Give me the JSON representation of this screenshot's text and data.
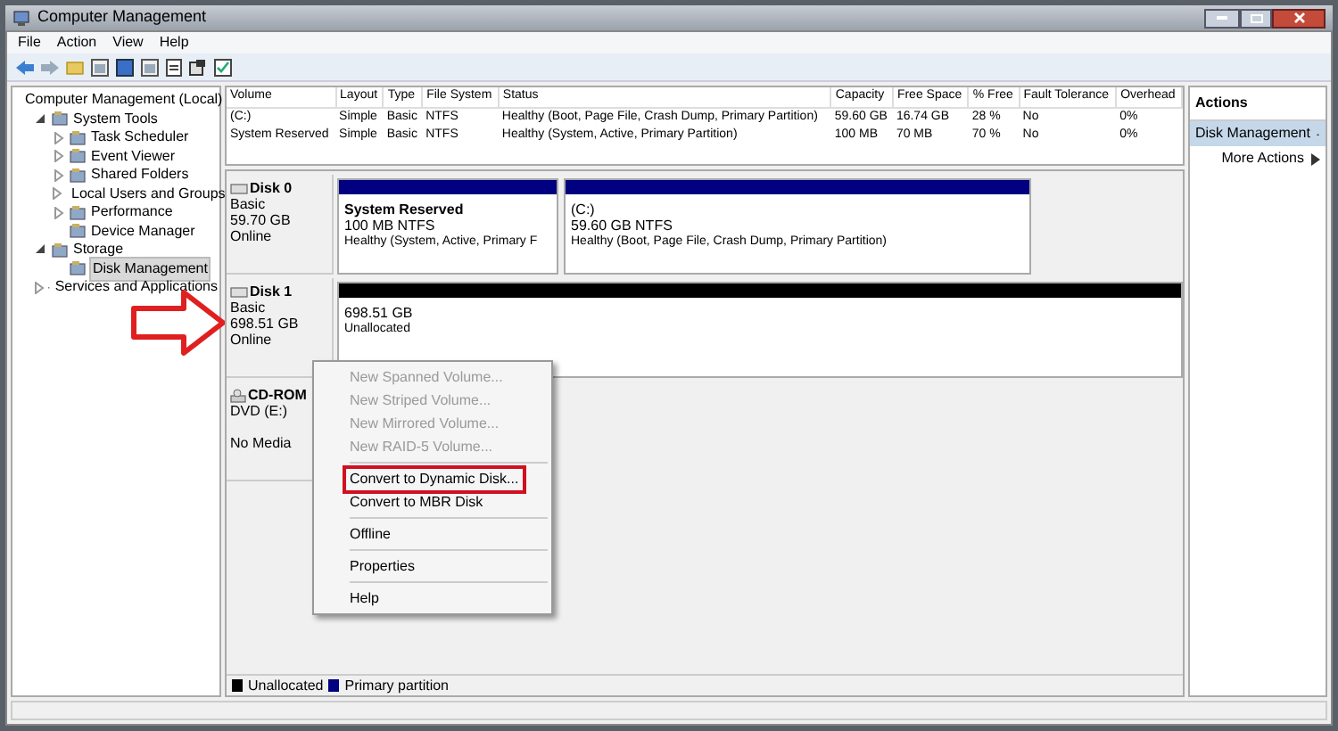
{
  "window": {
    "title": "Computer Management"
  },
  "menu": [
    "File",
    "Action",
    "View",
    "Help"
  ],
  "tree": [
    {
      "label": "Computer Management (Local)",
      "selected": false,
      "children": [
        {
          "label": "System Tools",
          "expanded": true,
          "selected": false,
          "children": [
            {
              "label": "Task Scheduler",
              "expanded": false,
              "selected": false
            },
            {
              "label": "Event Viewer",
              "expanded": false,
              "selected": false
            },
            {
              "label": "Shared Folders",
              "expanded": false,
              "selected": false
            },
            {
              "label": "Local Users and Groups",
              "expanded": false,
              "selected": false
            },
            {
              "label": "Performance",
              "expanded": false,
              "selected": false
            },
            {
              "label": "Device Manager",
              "selected": false
            }
          ]
        },
        {
          "label": "Storage",
          "expanded": true,
          "selected": false,
          "children": [
            {
              "label": "Disk Management",
              "selected": true
            }
          ]
        },
        {
          "label": "Services and Applications",
          "expanded": false,
          "selected": false
        }
      ]
    }
  ],
  "volumes": {
    "columns": [
      "Volume",
      "Layout",
      "Type",
      "File System",
      "Status",
      "Capacity",
      "Free Space",
      "% Free",
      "Fault Tolerance",
      "Overhead"
    ],
    "rows": [
      [
        "(C:)",
        "Simple",
        "Basic",
        "NTFS",
        "Healthy (Boot, Page File, Crash Dump, Primary Partition)",
        "59.60 GB",
        "16.74 GB",
        "28 %",
        "No",
        "0%"
      ],
      [
        "System Reserved",
        "Simple",
        "Basic",
        "NTFS",
        "Healthy (System, Active, Primary Partition)",
        "100 MB",
        "70 MB",
        "70 %",
        "No",
        "0%"
      ]
    ]
  },
  "disks": [
    {
      "kind": "disk",
      "name": "Disk 0",
      "type": "Basic",
      "size": "59.70 GB",
      "status": "Online",
      "partitions": [
        {
          "title": "System Reserved",
          "size": "100 MB NTFS",
          "status": "Healthy (System, Active, Primary F",
          "color": "#000080"
        },
        {
          "title": "(C:)",
          "size": "59.60 GB NTFS",
          "status": "Healthy (Boot, Page File, Crash Dump, Primary Partition)",
          "color": "#000080"
        }
      ]
    },
    {
      "kind": "disk",
      "name": "Disk 1",
      "type": "Basic",
      "size": "698.51 GB",
      "status": "Online",
      "partitions": [
        {
          "size": "698.51 GB",
          "status": "Unallocated",
          "color": "#000000"
        }
      ]
    },
    {
      "kind": "cdrom",
      "name": "CD-ROM",
      "type": "DVD (E:)",
      "status": "No Media"
    }
  ],
  "context_menu": [
    {
      "label": "New Spanned Volume...",
      "disabled": true,
      "highlighted": false,
      "separator_after": false
    },
    {
      "label": "New Striped Volume...",
      "disabled": true,
      "highlighted": false,
      "separator_after": false
    },
    {
      "label": "New Mirrored Volume...",
      "disabled": true,
      "highlighted": false,
      "separator_after": false
    },
    {
      "label": "New RAID-5 Volume...",
      "disabled": true,
      "highlighted": false,
      "separator_after": true
    },
    {
      "label": "Convert to Dynamic Disk...",
      "disabled": false,
      "highlighted": true,
      "separator_after": false
    },
    {
      "label": "Convert to MBR Disk",
      "disabled": false,
      "highlighted": false,
      "separator_after": true
    },
    {
      "label": "Offline",
      "disabled": false,
      "highlighted": false,
      "separator_after": true
    },
    {
      "label": "Properties",
      "disabled": false,
      "highlighted": false,
      "separator_after": true
    },
    {
      "label": "Help",
      "disabled": false,
      "highlighted": false,
      "separator_after": false
    }
  ],
  "legend": [
    {
      "label": "Unallocated",
      "color": "#000000"
    },
    {
      "label": "Primary partition",
      "color": "#000080"
    }
  ],
  "actions": {
    "title": "Actions",
    "items": [
      {
        "label": "Disk Management",
        "kind": "section",
        "selected": true
      },
      {
        "label": "More Actions",
        "kind": "submenu",
        "selected": false
      }
    ]
  }
}
